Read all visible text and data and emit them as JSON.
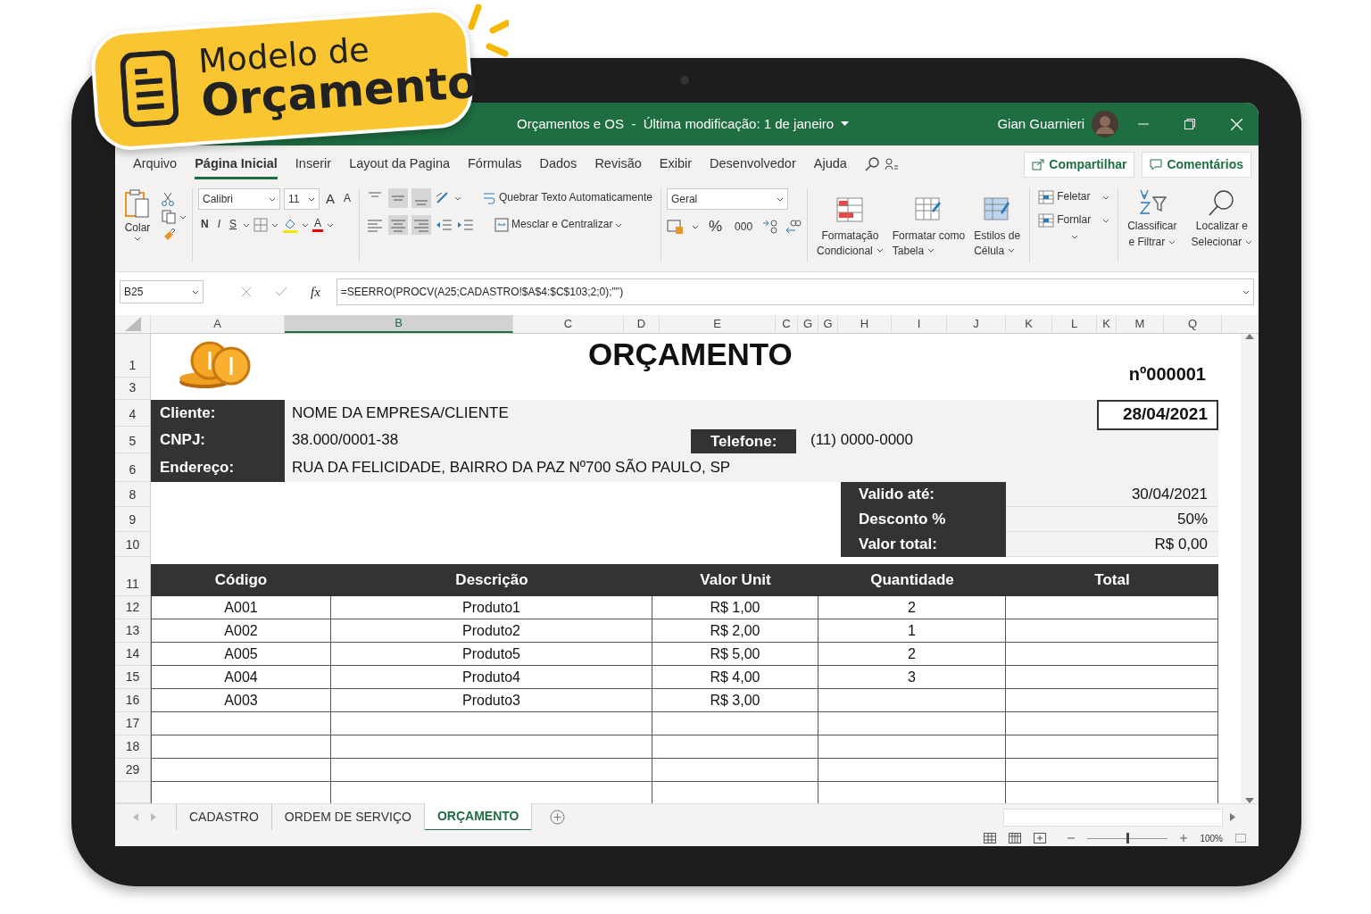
{
  "badge": {
    "line1": "Modelo de",
    "line2": "Orçamento"
  },
  "window": {
    "title": "Orçamentos e OS  -  Última modificação: 1 de janeiro",
    "user": "Gian Guarnieri"
  },
  "menu": [
    {
      "label": "Arquivo",
      "selected": false
    },
    {
      "label": "Página Inicial",
      "selected": true
    },
    {
      "label": "Inserir",
      "selected": false
    },
    {
      "label": "Layout da Pagina",
      "selected": false
    },
    {
      "label": "Fórmulas",
      "selected": false
    },
    {
      "label": "Dados",
      "selected": false
    },
    {
      "label": "Revisão",
      "selected": false
    },
    {
      "label": "Exibir",
      "selected": false
    },
    {
      "label": "Desenvolvedor",
      "selected": false
    },
    {
      "label": "Ajuda",
      "selected": false
    }
  ],
  "share": "Compartilhar",
  "comments": "Comentários",
  "ribbon": {
    "paste": "Colar",
    "font": "Calibri",
    "size": "11",
    "grow": "A",
    "shrink": "A",
    "bold": "N",
    "italic": "I",
    "underline": "S",
    "font_color": "A",
    "wrap": "Quebrar Texto Automaticamente",
    "merge": "Mesclar e Centralizar",
    "number_format": "Geral",
    "percent": "%",
    "thousands": "000",
    "styles": [
      {
        "line1": "Formatação",
        "line2": "Condicional"
      },
      {
        "line1": "Formatar como",
        "line2": "Tabela"
      },
      {
        "line1": "Estilos de",
        "line2": "Célula"
      }
    ],
    "cells": [
      "Feletar",
      "Fornlar"
    ],
    "editing": [
      {
        "line1": "Classificar",
        "line2": "e Filtrar"
      },
      {
        "line1": "Localizar e",
        "line2": "Selecionar"
      }
    ]
  },
  "formula_bar": {
    "name_box": "B25",
    "fx": "fx",
    "formula": "=SEERRO(PROCV(A25;CADASTRO!$A$4:$C$103;2;0);\"\")"
  },
  "columns": [
    {
      "label": "A",
      "selected": false
    },
    {
      "label": "B",
      "selected": true
    },
    {
      "label": "C",
      "selected": false
    },
    {
      "label": "D",
      "selected": false
    },
    {
      "label": "E",
      "selected": false
    },
    {
      "label": "C",
      "selected": false
    },
    {
      "label": "G",
      "selected": false
    },
    {
      "label": "G",
      "selected": false
    },
    {
      "label": "H",
      "selected": false
    },
    {
      "label": "I",
      "selected": false
    },
    {
      "label": "J",
      "selected": false
    },
    {
      "label": "K",
      "selected": false
    },
    {
      "label": "L",
      "selected": false
    },
    {
      "label": "K",
      "selected": false
    },
    {
      "label": "M",
      "selected": false
    },
    {
      "label": "Q",
      "selected": false
    }
  ],
  "row_numbers": [
    "1",
    "3",
    "4",
    "5",
    "6",
    "8",
    "9",
    "10",
    "11",
    "12",
    "13",
    "14",
    "15",
    "16",
    "17",
    "18",
    "29"
  ],
  "quote": {
    "title": "ORÇAMENTO",
    "number": "nº000001",
    "date": "28/04/2021"
  },
  "client": [
    {
      "label": "Cliente:",
      "value": "NOME DA EMPRESA/CLIENTE"
    },
    {
      "label": "CNPJ:",
      "value": "38.000/0001-38"
    },
    {
      "label": "Endereço:",
      "value": "RUA DA FELICIDADE, BAIRRO DA PAZ Nº700 SÃO PAULO, SP"
    }
  ],
  "phone": {
    "label": "Telefone:",
    "value": "(11) 0000-0000"
  },
  "summary": [
    {
      "label": "Valido até:",
      "value": "30/04/2021"
    },
    {
      "label": "Desconto %",
      "value": "50%"
    },
    {
      "label": "Valor total:",
      "value": "R$ 0,00"
    }
  ],
  "items": {
    "columns": [
      "Código",
      "Descrição",
      "Valor Unit",
      "Quantidade",
      "Total"
    ],
    "rows": [
      {
        "code": "A001",
        "description": "Produto1",
        "unit_price": "R$ 1,00",
        "quantity": "2"
      },
      {
        "code": "A002",
        "description": "Produto2",
        "unit_price": "R$ 2,00",
        "quantity": "1"
      },
      {
        "code": "A005",
        "description": "Produto5",
        "unit_price": "R$ 5,00",
        "quantity": "2"
      },
      {
        "code": "A004",
        "description": "Produto4",
        "unit_price": "R$ 4,00",
        "quantity": "3"
      },
      {
        "code": "A003",
        "description": "Produto3",
        "unit_price": "R$ 3,00"
      }
    ]
  },
  "sheet_tabs": [
    {
      "label": "CADASTRO",
      "selected": false
    },
    {
      "label": "ORDEM DE SERVIÇO",
      "selected": false
    },
    {
      "label": "ORÇAMENTO",
      "selected": true
    }
  ],
  "status": {
    "zoom": "100%",
    "zoom_slider": {
      "level": 0.5
    }
  }
}
